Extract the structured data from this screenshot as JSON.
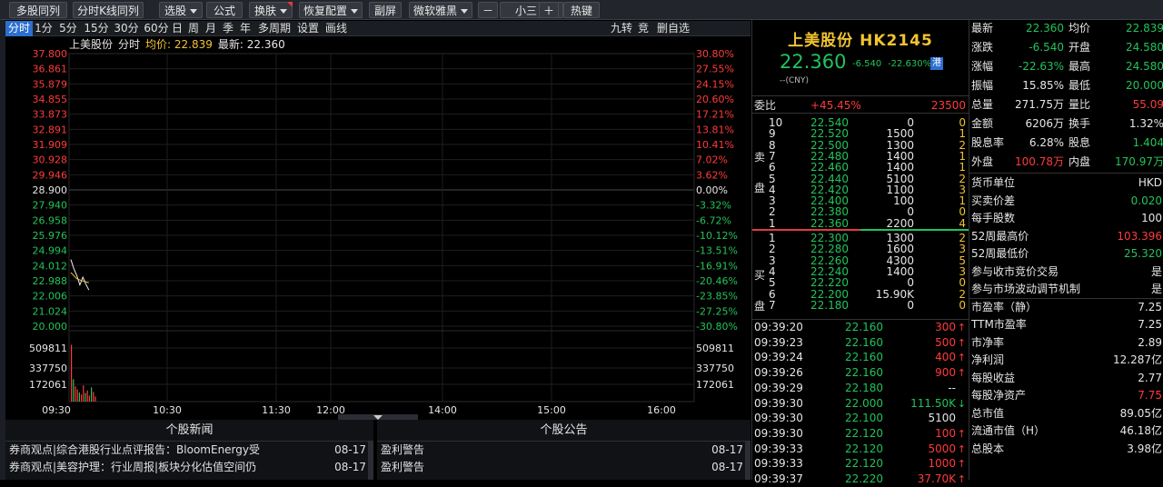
{
  "toolbar": {
    "buttons": [
      {
        "label": "多股同列",
        "dd": false
      },
      {
        "label": "分时K线同列",
        "dd": false
      },
      {
        "label": "选股",
        "dd": true
      },
      {
        "label": "公式",
        "dd": false
      },
      {
        "label": "换肤",
        "dd": true
      },
      {
        "label": "恢复配置",
        "dd": true
      },
      {
        "label": "副屏",
        "dd": false
      },
      {
        "label": "微软雅黑",
        "dd": true
      },
      {
        "label": "－",
        "dd": false
      },
      {
        "label": "小三",
        "dd": true
      },
      {
        "label": "＋",
        "dd": false
      },
      {
        "label": "热键",
        "dd": false
      }
    ]
  },
  "periods": [
    "分时",
    "1分",
    "5分",
    "15分",
    "30分",
    "60分",
    "日",
    "周",
    "月",
    "季",
    "年",
    "多周期",
    "设置",
    "画线"
  ],
  "period_right": [
    "九转",
    "竞",
    "删自选"
  ],
  "chart_header": {
    "name": "上美股份",
    "mode": "分时",
    "avg_label": "均价: 22.839",
    "last_label": "最新: 22.360"
  },
  "chart_data": {
    "type": "line",
    "price_ticks": [
      "37.800",
      "36.861",
      "35.879",
      "34.855",
      "33.873",
      "32.891",
      "31.909",
      "30.928",
      "29.946",
      "28.900",
      "27.940",
      "26.958",
      "25.976",
      "24.994",
      "24.012",
      "22.988",
      "22.006",
      "21.024",
      "20.000"
    ],
    "pct_ticks": [
      "30.80%",
      "27.55%",
      "24.15%",
      "20.60%",
      "17.21%",
      "13.81%",
      "10.41%",
      "7.02%",
      "3.62%",
      "0.00%",
      "-3.32%",
      "-6.72%",
      "-10.12%",
      "-13.51%",
      "-16.91%",
      "-20.46%",
      "-23.85%",
      "-27.25%",
      "-30.80%"
    ],
    "ylim": [
      20.0,
      37.8
    ],
    "prev_close": 28.9,
    "time_labels": [
      "09:30",
      "10:30",
      "11:30",
      "12:00",
      "14:00",
      "15:00",
      "16:00"
    ],
    "vol_ticks": [
      "509811",
      "337750",
      "172061"
    ],
    "price_series": [
      {
        "t": 0,
        "p": 24.35
      },
      {
        "t": 1,
        "p": 23.75
      },
      {
        "t": 2,
        "p": 23.3
      },
      {
        "t": 3,
        "p": 22.7
      },
      {
        "t": 4,
        "p": 23.2
      },
      {
        "t": 5,
        "p": 22.75
      },
      {
        "t": 6,
        "p": 22.36
      }
    ],
    "avg_series": [
      {
        "t": 0,
        "p": 23.5
      },
      {
        "t": 2,
        "p": 23.1
      },
      {
        "t": 4,
        "p": 22.95
      },
      {
        "t": 6,
        "p": 22.84
      }
    ],
    "volumes": [
      560000,
      220000,
      150000,
      120000,
      90000,
      70000,
      160000,
      85000,
      110000,
      60000,
      140000,
      95000,
      50000
    ],
    "vol_max": 680000
  },
  "news": {
    "title": "个股新闻",
    "items": [
      {
        "text": "券商观点|综合港股行业点评报告：BloomEnergy受",
        "date": "08-17"
      },
      {
        "text": "券商观点|美容护理：行业周报|板块分化估值空间仍",
        "date": "08-17"
      }
    ]
  },
  "announcements": {
    "title": "个股公告",
    "items": [
      {
        "text": "盈利警告",
        "date": "08-17"
      },
      {
        "text": "盈利警告",
        "date": "08-17"
      }
    ]
  },
  "quote": {
    "name": "上美股份 HK2145",
    "price": "22.360",
    "change": "-6.540",
    "change_pct": "-22.630%",
    "market": "港",
    "currency": "--(CNY)",
    "weibi_label": "委比",
    "weibi_value": "+45.45%",
    "weicha": "23500"
  },
  "orderbook": {
    "sell_label": [
      "卖",
      "盘"
    ],
    "buy_label": [
      "买",
      "盘"
    ],
    "asks": [
      {
        "lvl": "10",
        "price": "22.540",
        "vol": "0",
        "cnt": "0"
      },
      {
        "lvl": "9",
        "price": "22.520",
        "vol": "1500",
        "cnt": "1"
      },
      {
        "lvl": "8",
        "price": "22.500",
        "vol": "1300",
        "cnt": "2"
      },
      {
        "lvl": "7",
        "price": "22.480",
        "vol": "1400",
        "cnt": "1"
      },
      {
        "lvl": "6",
        "price": "22.460",
        "vol": "1400",
        "cnt": "1"
      },
      {
        "lvl": "5",
        "price": "22.440",
        "vol": "5100",
        "cnt": "2"
      },
      {
        "lvl": "4",
        "price": "22.420",
        "vol": "1100",
        "cnt": "3"
      },
      {
        "lvl": "3",
        "price": "22.400",
        "vol": "100",
        "cnt": "1"
      },
      {
        "lvl": "2",
        "price": "22.380",
        "vol": "0",
        "cnt": "0"
      },
      {
        "lvl": "1",
        "price": "22.360",
        "vol": "2200",
        "cnt": "4"
      }
    ],
    "bids": [
      {
        "lvl": "1",
        "price": "22.300",
        "vol": "1300",
        "cnt": "2"
      },
      {
        "lvl": "2",
        "price": "22.280",
        "vol": "1600",
        "cnt": "3"
      },
      {
        "lvl": "3",
        "price": "22.260",
        "vol": "4300",
        "cnt": "5"
      },
      {
        "lvl": "4",
        "price": "22.240",
        "vol": "1400",
        "cnt": "3"
      },
      {
        "lvl": "5",
        "price": "22.220",
        "vol": "0",
        "cnt": "0"
      },
      {
        "lvl": "6",
        "price": "22.200",
        "vol": "15.90K",
        "cnt": "2"
      },
      {
        "lvl": "7",
        "price": "22.180",
        "vol": "0",
        "cnt": "0"
      }
    ]
  },
  "ticks": [
    {
      "time": "09:39:20",
      "price": "22.160",
      "vol": "300",
      "dir": "up"
    },
    {
      "time": "09:39:23",
      "price": "22.160",
      "vol": "500",
      "dir": "up"
    },
    {
      "time": "09:39:24",
      "price": "22.160",
      "vol": "400",
      "dir": "up"
    },
    {
      "time": "09:39:26",
      "price": "22.160",
      "vol": "900",
      "dir": "up"
    },
    {
      "time": "09:39:29",
      "price": "22.180",
      "vol": "--",
      "dir": "none"
    },
    {
      "time": "09:39:30",
      "price": "22.000",
      "vol": "111.50K",
      "dir": "down"
    },
    {
      "time": "09:39:30",
      "price": "22.100",
      "vol": "5100",
      "dir": "neutral"
    },
    {
      "time": "09:39:30",
      "price": "22.120",
      "vol": "100",
      "dir": "up"
    },
    {
      "time": "09:39:33",
      "price": "22.120",
      "vol": "5000",
      "dir": "up"
    },
    {
      "time": "09:39:33",
      "price": "22.120",
      "vol": "1000",
      "dir": "up"
    },
    {
      "time": "09:39:37",
      "price": "22.220",
      "vol": "37.70K",
      "dir": "up"
    }
  ],
  "stats": [
    [
      {
        "l": "最新",
        "v": "22.360",
        "c": "green"
      },
      {
        "l": "均价",
        "v": "22.839",
        "c": "green"
      }
    ],
    [
      {
        "l": "涨跌",
        "v": "-6.540",
        "c": "green"
      },
      {
        "l": "开盘",
        "v": "24.580",
        "c": "green"
      }
    ],
    [
      {
        "l": "涨幅",
        "v": "-22.63%",
        "c": "green"
      },
      {
        "l": "最高",
        "v": "24.580",
        "c": "green"
      }
    ],
    [
      {
        "l": "振幅",
        "v": "15.85%",
        "c": "white"
      },
      {
        "l": "最低",
        "v": "20.000",
        "c": "green"
      }
    ],
    [
      {
        "l": "总量",
        "v": "271.75万",
        "c": "white"
      },
      {
        "l": "量比",
        "v": "55.09",
        "c": "red"
      }
    ],
    [
      {
        "l": "金额",
        "v": "6206万",
        "c": "white"
      },
      {
        "l": "换手",
        "v": "1.32%",
        "c": "white"
      }
    ],
    [
      {
        "l": "股息率",
        "v": "6.28%",
        "c": "white"
      },
      {
        "l": "股息",
        "v": "1.404",
        "c": "green"
      }
    ],
    [
      {
        "l": "外盘",
        "v": "100.78万",
        "c": "red"
      },
      {
        "l": "内盘",
        "v": "170.97万",
        "c": "green"
      }
    ]
  ],
  "info": [
    {
      "l": "货币单位",
      "v": "HKD",
      "c": "white"
    },
    {
      "l": "买卖价差",
      "v": "0.020",
      "c": "green"
    },
    {
      "l": "每手股数",
      "v": "100",
      "c": "white"
    },
    {
      "l": "52周最高价",
      "v": "103.396",
      "c": "red"
    },
    {
      "l": "52周最低价",
      "v": "25.320",
      "c": "green"
    },
    {
      "l": "参与收市竞价交易",
      "v": "是",
      "c": "white"
    },
    {
      "l": "参与市场波动调节机制",
      "v": "是",
      "c": "white"
    },
    {
      "l": "市盈率（静）",
      "v": "7.25",
      "c": "white"
    },
    {
      "l": "TTM市盈率",
      "v": "7.25",
      "c": "white"
    },
    {
      "l": "市净率",
      "v": "2.89",
      "c": "white"
    },
    {
      "l": "净利润",
      "v": "12.287亿",
      "c": "white"
    },
    {
      "l": "每股收益",
      "v": "2.77",
      "c": "white"
    },
    {
      "l": "每股净资产",
      "v": "7.75",
      "c": "red"
    },
    {
      "l": "总市值",
      "v": "89.05亿",
      "c": "white"
    },
    {
      "l": "流通市值（H）",
      "v": "46.18亿",
      "c": "white"
    },
    {
      "l": "总股本",
      "v": "3.98亿",
      "c": "white"
    }
  ],
  "colors": {
    "red": "#ff3b3b",
    "green": "#22c35a",
    "white": "#e6e6e6",
    "gray": "#c8c8c8",
    "yellow": "#f2c230",
    "accent": "#2c6fd0"
  }
}
